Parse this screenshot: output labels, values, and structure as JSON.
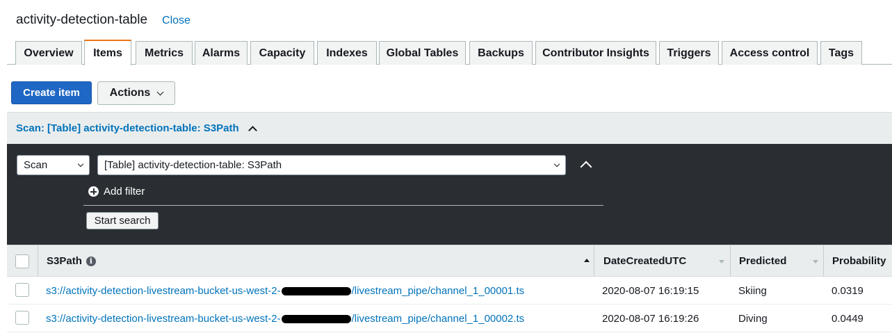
{
  "header": {
    "table_name": "activity-detection-table",
    "close_label": "Close"
  },
  "tabs": [
    {
      "label": "Overview",
      "active": false
    },
    {
      "label": "Items",
      "active": true
    },
    {
      "label": "Metrics",
      "active": false
    },
    {
      "label": "Alarms",
      "active": false
    },
    {
      "label": "Capacity",
      "active": false
    },
    {
      "label": "Indexes",
      "active": false
    },
    {
      "label": "Global Tables",
      "active": false
    },
    {
      "label": "Backups",
      "active": false
    },
    {
      "label": "Contributor Insights",
      "active": false
    },
    {
      "label": "Triggers",
      "active": false
    },
    {
      "label": "Access control",
      "active": false
    },
    {
      "label": "Tags",
      "active": false
    }
  ],
  "toolbar": {
    "create_label": "Create item",
    "actions_label": "Actions"
  },
  "scan": {
    "header_label": "Scan: [Table] activity-detection-table: S3Path",
    "mode_value": "Scan",
    "target_value": "[Table] activity-detection-table: S3Path",
    "add_filter_label": "Add filter",
    "start_search_label": "Start search"
  },
  "table": {
    "columns": [
      "S3Path",
      "DateCreatedUTC",
      "Predicted",
      "Probability"
    ],
    "rows": [
      {
        "path_prefix": "s3://activity-detection-livestream-bucket-us-west-2-",
        "path_suffix": "/livestream_pipe/channel_1_00001.ts",
        "date": "2020-08-07 16:19:15",
        "predicted": "Skiing",
        "probability": "0.0319"
      },
      {
        "path_prefix": "s3://activity-detection-livestream-bucket-us-west-2-",
        "path_suffix": "/livestream_pipe/channel_1_00002.ts",
        "date": "2020-08-07 16:19:26",
        "predicted": "Diving",
        "probability": "0.0449"
      }
    ]
  },
  "colors": {
    "accent": "#ec7211",
    "primary_button": "#1f67c4",
    "link": "#0073bb",
    "panel": "#2a2e33"
  }
}
